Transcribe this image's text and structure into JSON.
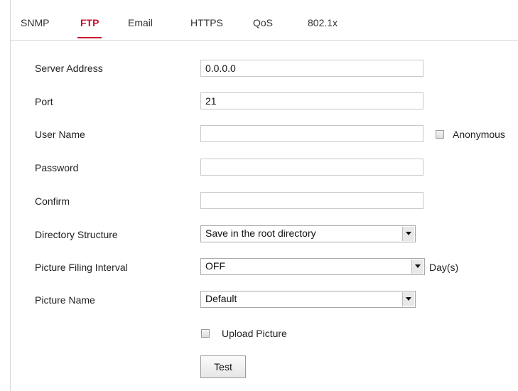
{
  "tabs": [
    {
      "label": "SNMP"
    },
    {
      "label": "FTP"
    },
    {
      "label": "Email"
    },
    {
      "label": "HTTPS"
    },
    {
      "label": "QoS"
    },
    {
      "label": "802.1x"
    }
  ],
  "active_tab": "FTP",
  "form": {
    "server_address": {
      "label": "Server Address",
      "value": "0.0.0.0"
    },
    "port": {
      "label": "Port",
      "value": "21"
    },
    "user_name": {
      "label": "User Name",
      "value": ""
    },
    "anonymous": {
      "label": "Anonymous",
      "checked": false
    },
    "password": {
      "label": "Password",
      "value": ""
    },
    "confirm": {
      "label": "Confirm",
      "value": ""
    },
    "directory_structure": {
      "label": "Directory Structure",
      "value": "Save in the root directory"
    },
    "picture_filing_interval": {
      "label": "Picture Filing Interval",
      "value": "OFF",
      "unit": "Day(s)"
    },
    "picture_name": {
      "label": "Picture Name",
      "value": "Default"
    },
    "upload_picture": {
      "label": "Upload Picture",
      "checked": false
    },
    "test_button": "Test"
  },
  "colors": {
    "accent": "#c8102e",
    "border": "#d6d6d6"
  }
}
